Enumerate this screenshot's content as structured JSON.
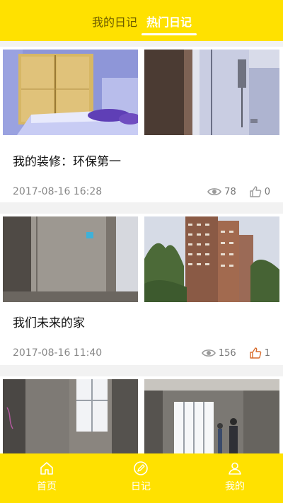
{
  "tabs": {
    "mine": "我的日记",
    "hot": "热门日记"
  },
  "posts": [
    {
      "title": "我的装修：环保第一",
      "date": "2017-08-16 16:28",
      "views": "78",
      "likes": "0",
      "liked": false
    },
    {
      "title": "我们未来的家",
      "date": "2017-08-16 11:40",
      "views": "156",
      "likes": "1",
      "liked": true
    }
  ],
  "nav": {
    "home": "首页",
    "diary": "日记",
    "mine": "我的"
  },
  "colors": {
    "accent": "#ffe100",
    "liked": "#d86b2b",
    "muted": "#888888"
  }
}
